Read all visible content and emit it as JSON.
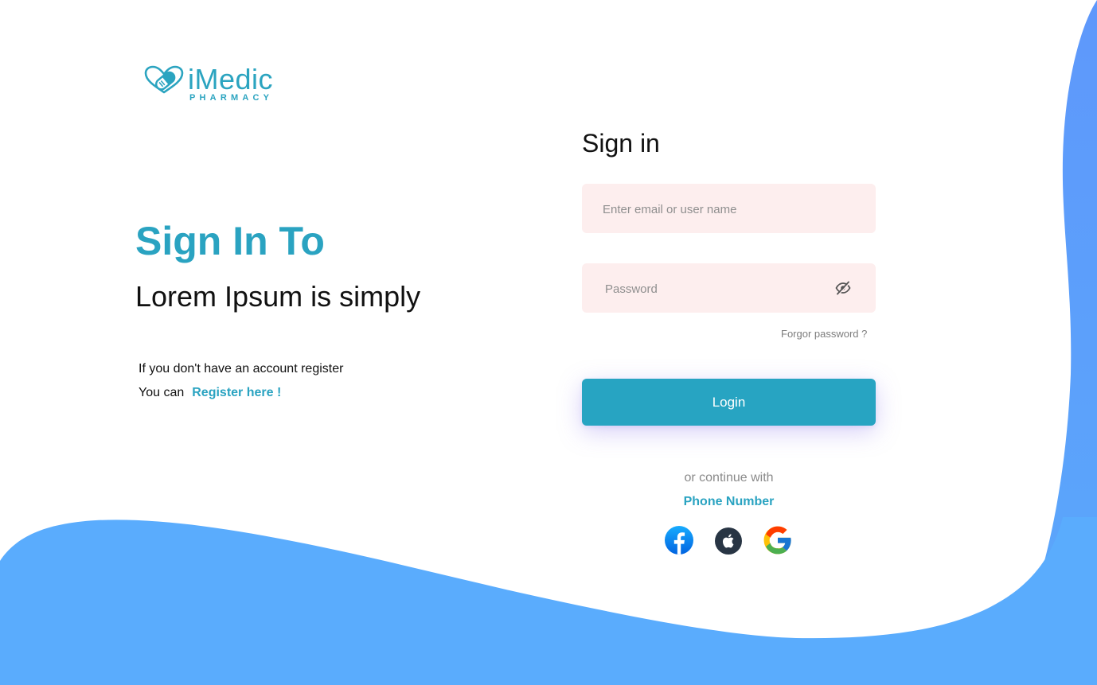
{
  "colors": {
    "accent": "#2aa3c1",
    "wave_blue": "#5aa8fb",
    "field_background": "#fdeeee",
    "login_button": "#27a4c2"
  },
  "brand": {
    "name": "iMedic",
    "tagline": "PHARMACY",
    "logo_icon": "heart-pill-icon"
  },
  "hero": {
    "title": "Sign In To",
    "subtitle": "Lorem Ipsum is simply",
    "register_prompt": "If you don't have an account register",
    "register_prefix": "You can",
    "register_link": "Register here !"
  },
  "signin": {
    "title": "Sign in",
    "email_placeholder": "Enter email or user name",
    "password_placeholder": "Password",
    "password_toggle_icon": "eye-off-icon",
    "forgot_password": "Forgor password ?",
    "login_button": "Login",
    "or_continue": "or continue with",
    "phone_link": "Phone Number",
    "social_icons": [
      "facebook-icon",
      "apple-icon",
      "google-icon"
    ]
  }
}
